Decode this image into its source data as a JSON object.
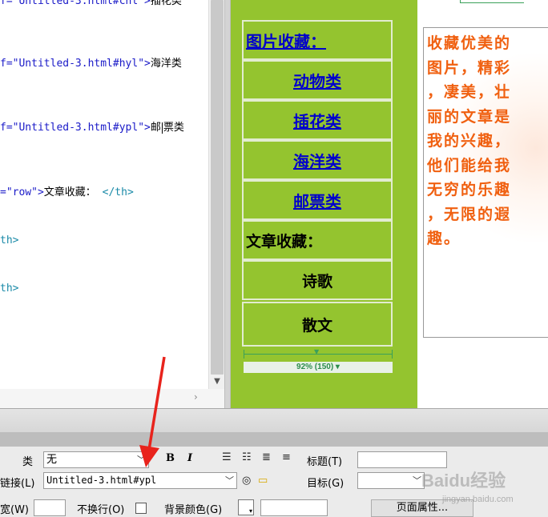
{
  "code": {
    "lines": [
      {
        "prefix": "f=",
        "value": "\"Untitled-3.html#chl\"",
        "close": ">",
        "text": "插花类"
      },
      {
        "prefix": "f=",
        "value": "\"Untitled-3.html#hyl\"",
        "close": ">",
        "text": "海洋类"
      },
      {
        "prefix": "f=",
        "value": "\"Untitled-3.html#ypl\"",
        "close": ">",
        "text_a": "邮",
        "text_b": "票类"
      },
      {
        "prefix": "=",
        "value": "\"row\"",
        "close": ">",
        "text": "文章收藏：",
        "end_tag": "</th>"
      },
      {
        "tag": "th>"
      },
      {
        "tag": "th>"
      }
    ]
  },
  "design": {
    "nav": {
      "header": "图片收藏：",
      "links": [
        "动物类",
        "插花类",
        "海洋类",
        "邮票类"
      ],
      "section": "文章收藏：",
      "items": [
        "诗歌",
        "散文"
      ]
    },
    "ruler": {
      "label": "92% (150)"
    },
    "article_lines": [
      "收藏优美的",
      "图片，精彩",
      "，凄美，壮",
      "丽的文章是",
      "我的兴趣，",
      "他们能给我",
      "无穷的乐趣",
      "，无限的遐",
      "趣。"
    ]
  },
  "properties": {
    "class_label": "类",
    "class_value": "无",
    "bold": "B",
    "italic": "I",
    "title_label": "标题(T)",
    "title_value": "",
    "link_label": "链接(L)",
    "link_value": "Untitled-3.html#ypl",
    "target_label": "目标(G)",
    "target_value": "",
    "width_label": "宽(W)",
    "width_value": "",
    "nowrap_label": "不换行(O)",
    "bgcolor_label": "背景颜色(G)",
    "bgcolor_value": "",
    "page_props_label": "页面属性..."
  },
  "watermark": {
    "text": "Baidu经验",
    "sub": "jingyan.baidu.com"
  },
  "colors": {
    "panel_green": "#94c42f",
    "article_orange": "#f06010",
    "link_blue": "#0000cc",
    "arrow_red": "#e8231c"
  }
}
